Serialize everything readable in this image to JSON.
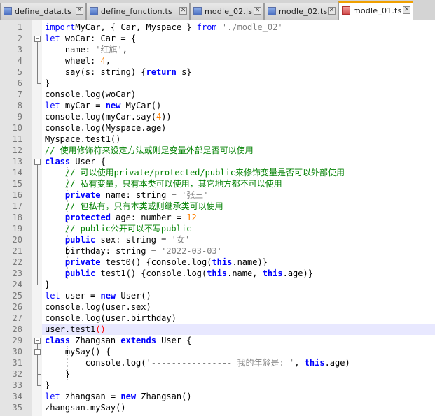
{
  "tabs": [
    {
      "label": "define_data.ts",
      "active": false
    },
    {
      "label": "define_function.ts",
      "active": false
    },
    {
      "label": "modle_02.js",
      "active": false
    },
    {
      "label": "modle_02.ts",
      "active": false
    },
    {
      "label": "modle_01.ts",
      "active": true
    }
  ],
  "icons": {
    "file": "file-icon",
    "close": "close-icon",
    "fold": "fold-minus-icon"
  },
  "colors": {
    "keyword": "#0000ff",
    "string": "#808080",
    "number": "#ff8000",
    "comment": "#008000",
    "current_line": "#e8e8ff"
  },
  "editor": {
    "current_line": 28,
    "lines": [
      [
        [
          "kw2",
          "import"
        ],
        [
          "",
          "MyCar, { Car, Myspace } "
        ],
        [
          "kw2",
          "from"
        ],
        [
          "",
          " "
        ],
        [
          "str",
          "'./modle_02'"
        ]
      ],
      [
        [
          "kw2",
          "let"
        ],
        [
          "",
          " woCar: Car = {"
        ]
      ],
      [
        [
          "",
          "  name: "
        ],
        [
          "str",
          "'红旗'"
        ],
        [
          "",
          ","
        ]
      ],
      [
        [
          "",
          "  wheel: "
        ],
        [
          "num",
          "4"
        ],
        [
          "",
          ","
        ]
      ],
      [
        [
          "",
          "  say(s: string) {"
        ],
        [
          "kw",
          "return"
        ],
        [
          "",
          " s}"
        ]
      ],
      [
        [
          "",
          "}"
        ]
      ],
      [
        [
          "",
          "console.log(woCar)"
        ]
      ],
      [
        [
          "kw2",
          "let"
        ],
        [
          "",
          " myCar = "
        ],
        [
          "kw",
          "new"
        ],
        [
          "",
          " MyCar()"
        ]
      ],
      [
        [
          "",
          "console.log(myCar.say("
        ],
        [
          "num",
          "4"
        ],
        [
          "",
          "))"
        ]
      ],
      [
        [
          "",
          "console.log(Myspace.age)"
        ]
      ],
      [
        [
          "",
          "Myspace.test1()"
        ]
      ],
      [
        [
          "cmt",
          "// 使用修饰符来设定方法或则是变量外部是否可以使用"
        ]
      ],
      [
        [
          "kw",
          "class"
        ],
        [
          "",
          " User {"
        ]
      ],
      [
        [
          "cmt",
          "  // 可以使用private/protected/public来修饰变量是否可以外部使用"
        ]
      ],
      [
        [
          "cmt",
          "  // 私有变量，只有本类可以使用，其它地方都不可以使用"
        ]
      ],
      [
        [
          "kw",
          "  private"
        ],
        [
          "",
          " name: string = "
        ],
        [
          "str",
          "'张三'"
        ]
      ],
      [
        [
          "cmt",
          "  // 包私有，只有本类或则继承类可以使用"
        ]
      ],
      [
        [
          "kw",
          "  protected"
        ],
        [
          "",
          " age: number = "
        ],
        [
          "num",
          "12"
        ]
      ],
      [
        [
          "cmt",
          "  // public公开可以不写public"
        ]
      ],
      [
        [
          "kw",
          "  public"
        ],
        [
          "",
          " sex: string = "
        ],
        [
          "str",
          "'女'"
        ]
      ],
      [
        [
          "",
          "  birthday: string = "
        ],
        [
          "str",
          "'2022-03-03'"
        ]
      ],
      [
        [
          "kw",
          "  private"
        ],
        [
          "",
          " test0() {console.log("
        ],
        [
          "kw",
          "this"
        ],
        [
          "",
          ".name)}"
        ]
      ],
      [
        [
          "kw",
          "  public"
        ],
        [
          "",
          " test1() {console.log("
        ],
        [
          "kw",
          "this"
        ],
        [
          "",
          ".name, "
        ],
        [
          "kw",
          "this"
        ],
        [
          "",
          ".age)}"
        ]
      ],
      [
        [
          "",
          "}"
        ]
      ],
      [
        [
          "kw2",
          "let"
        ],
        [
          "",
          " user = "
        ],
        [
          "kw",
          "new"
        ],
        [
          "",
          " User()"
        ]
      ],
      [
        [
          "",
          "console.log(user.sex)"
        ]
      ],
      [
        [
          "",
          "console.log(user.birthday)"
        ]
      ],
      [
        [
          "",
          "user.test1"
        ],
        [
          "bracehl",
          "()"
        ]
      ],
      [
        [
          "kw",
          "class"
        ],
        [
          "",
          " Zhangsan "
        ],
        [
          "kw",
          "extends"
        ],
        [
          "",
          " User {"
        ]
      ],
      [
        [
          "",
          "  mySay() {"
        ]
      ],
      [
        [
          "",
          "    console.log("
        ],
        [
          "str",
          "'---------------- 我的年龄是: '"
        ],
        [
          "",
          ", "
        ],
        [
          "kw",
          "this"
        ],
        [
          "",
          ".age)"
        ]
      ],
      [
        [
          "",
          "  }"
        ]
      ],
      [
        [
          "",
          "}"
        ]
      ],
      [
        [
          "kw2",
          "let"
        ],
        [
          "",
          " zhangsan = "
        ],
        [
          "kw",
          "new"
        ],
        [
          "",
          " Zhangsan()"
        ]
      ],
      [
        [
          "",
          "zhangsan.mySay()"
        ]
      ]
    ]
  }
}
